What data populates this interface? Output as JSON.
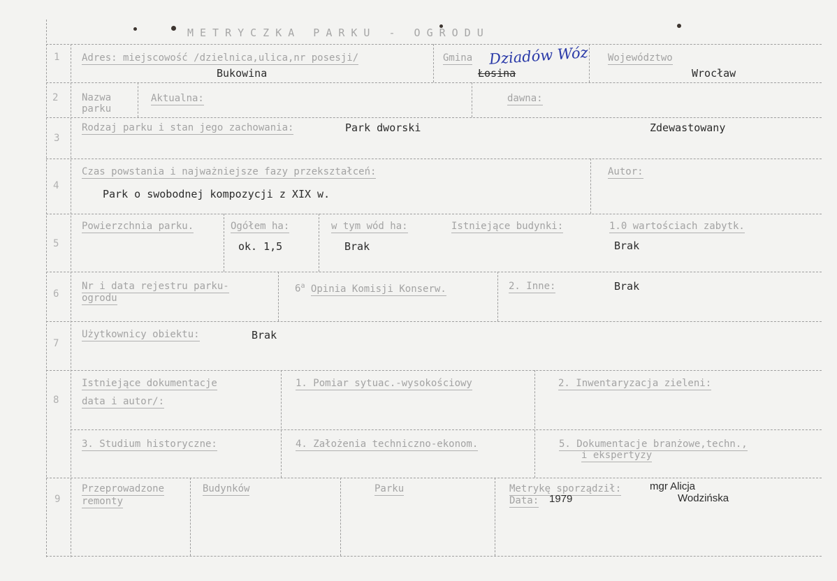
{
  "title": "METRYCZKA PARKU - OGRODU",
  "row_numbers": [
    "1",
    "2",
    "3",
    "4",
    "5",
    "6",
    "7",
    "8",
    "9"
  ],
  "row1": {
    "address_label": "Adres: miejscowość /dzielnica,ulica,nr posesji/",
    "address_value": "Bukowina",
    "gmina_label": "Gmina",
    "gmina_handwritten": "Dziadów Wóz",
    "gmina_struck": "Łosina",
    "voivodeship_label": "Województwo",
    "voivodeship_value": "Wrocław"
  },
  "row2": {
    "name_label": "Nazwa parku",
    "current_label": "Aktualna:",
    "former_label": "dawna:"
  },
  "row3": {
    "type_label": "Rodzaj parku i stan jego zachowania:",
    "type_value": "Park dworski",
    "state_value": "Zdewastowany"
  },
  "row4": {
    "history_label": "Czas powstania i najważniejsze fazy przekształceń:",
    "history_value": "Park o swobodnej kompozycji z XIX w.",
    "author_label": "Autor:"
  },
  "row5": {
    "area_label": "Powierzchnia parku.",
    "total_label": "Ogółem ha:",
    "total_value": "ok. 1,5",
    "water_label": "w tym wód ha:",
    "water_value": "Brak",
    "buildings_label": "Istniejące budynki:",
    "monuments_label": "1.0 wartościach zabytk.",
    "monuments_value": "Brak"
  },
  "row6": {
    "register_label_1": "Nr i data rejestru parku-",
    "register_label_2": "ogrodu",
    "opinion_label": "Opinia Komisji Konserw.",
    "opinion_number": "6",
    "opinion_sup": "a",
    "other_label": "2. Inne:",
    "other_value": "Brak"
  },
  "row7": {
    "users_label": "Użytkownicy obiektu:",
    "users_value": "Brak"
  },
  "row8": {
    "docs_label_1": "Istniejące dokumentacje",
    "docs_label_2": "data i autor/:",
    "doc1": "1. Pomiar sytuac.-wysokościowy",
    "doc2": "2. Inwentaryzacja zieleni:",
    "doc3": "3. Studium historyczne:",
    "doc4": "4. Założenia techniczno-ekonom.",
    "doc5_1": "5. Dokumentacje branżowe,techn.,",
    "doc5_2": "i ekspertyzy"
  },
  "row9": {
    "repairs_label_1": "Przeprowadzone",
    "repairs_label_2": "remonty",
    "buildings_label": "Budynków",
    "park_label": "Parku",
    "prepared_label": "Metrykę sporządził:",
    "prepared_value_1": "mgr Alicja",
    "prepared_value_2": "Wodzińska",
    "date_label": "Data:",
    "date_value": "1979"
  }
}
